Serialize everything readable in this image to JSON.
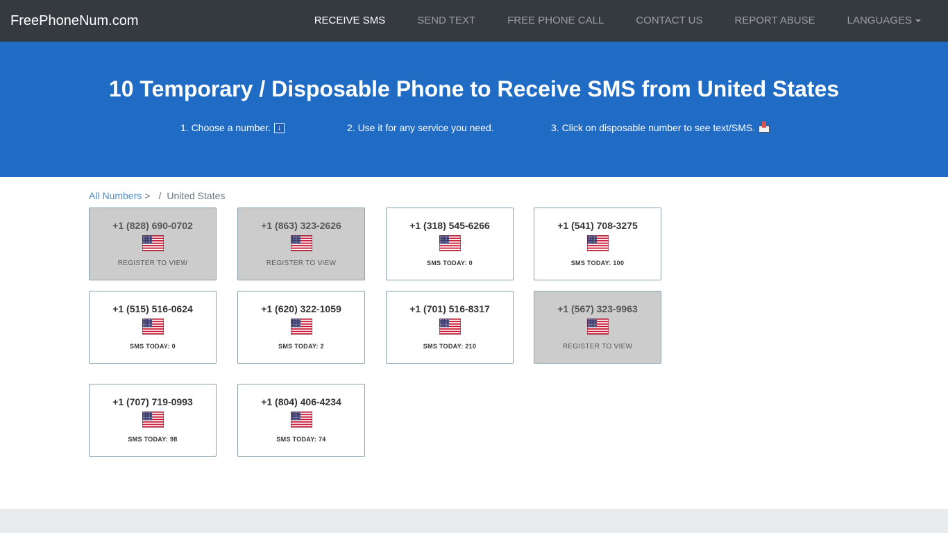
{
  "brand": "FreePhoneNum.com",
  "nav": [
    {
      "label": "RECEIVE SMS",
      "active": true
    },
    {
      "label": "SEND TEXT",
      "active": false
    },
    {
      "label": "FREE PHONE CALL",
      "active": false
    },
    {
      "label": "CONTACT US",
      "active": false
    },
    {
      "label": "REPORT ABUSE",
      "active": false
    },
    {
      "label": "LANGUAGES",
      "active": false
    }
  ],
  "hero": {
    "title": "10 Temporary / Disposable Phone to Receive SMS from United States",
    "steps": [
      "1. Choose a number.",
      "2. Use it for any service you need.",
      "3. Click on disposable number to see text/SMS."
    ]
  },
  "breadcrumb": {
    "link": "All Numbers",
    "link_suffix": ">",
    "separator": "/",
    "current": "United States"
  },
  "numbers": [
    {
      "number": "+1 (828) 690-0702",
      "status": "REGISTER TO VIEW",
      "locked": true
    },
    {
      "number": "+1 (863) 323-2626",
      "status": "REGISTER TO VIEW",
      "locked": true
    },
    {
      "number": "+1 (318) 545-6266",
      "status": "SMS TODAY: 0",
      "locked": false
    },
    {
      "number": "+1 (541) 708-3275",
      "status": "SMS TODAY: 100",
      "locked": false
    },
    {
      "number": "+1 (515) 516-0624",
      "status": "SMS TODAY: 0",
      "locked": false
    },
    {
      "number": "+1 (620) 322-1059",
      "status": "SMS TODAY: 2",
      "locked": false
    },
    {
      "number": "+1 (701) 516-8317",
      "status": "SMS TODAY: 210",
      "locked": false
    },
    {
      "number": "+1 (567) 323-9963",
      "status": "REGISTER TO VIEW",
      "locked": true
    },
    {
      "number": "+1 (707) 719-0993",
      "status": "SMS TODAY: 98",
      "locked": false
    },
    {
      "number": "+1 (804) 406-4234",
      "status": "SMS TODAY: 74",
      "locked": false
    }
  ],
  "colors": {
    "navbar": "#343a40",
    "hero": "#206bc4",
    "card_locked": "#cccccc",
    "link": "#4a89c8"
  }
}
